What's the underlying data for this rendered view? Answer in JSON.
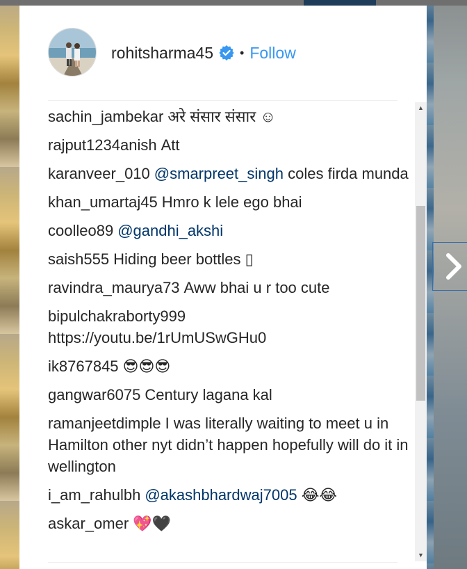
{
  "post_header": {
    "username": "rohitsharma45",
    "separator": "•",
    "follow_label": "Follow"
  },
  "icons": {
    "verified": "verified-badge-icon",
    "next": "chevron-right-icon",
    "scroll_up": "scroll-up-arrow-icon",
    "scroll_down": "scroll-down-arrow-icon"
  },
  "colors": {
    "follow": "#3897f0",
    "mention": "#003569",
    "verified": "#3897f0",
    "text": "#262626"
  },
  "comments": [
    {
      "user": "sachin_jambekar",
      "text": "अरे संसार संसार ☺",
      "mention": ""
    },
    {
      "user": "rajput1234anish",
      "text": "Att",
      "mention": ""
    },
    {
      "user": "karanveer_010",
      "mention": "@smarpreet_singh",
      "text": "coles firda munda"
    },
    {
      "user": "khan_umartaj45",
      "text": "Hmro k lele ego bhai",
      "mention": ""
    },
    {
      "user": "coolleo89",
      "mention": "@gandhi_akshi",
      "text": ""
    },
    {
      "user": "saish555",
      "text": "Hiding beer bottles ▯",
      "mention": ""
    },
    {
      "user": "ravindra_maurya73",
      "text": "Aww bhai u r too cute",
      "mention": ""
    },
    {
      "user": "bipulchakraborty999",
      "text": "https://youtu.be/1rUmUSwGHu0",
      "mention": ""
    },
    {
      "user": "ik8767845",
      "text": "😎😎😎",
      "mention": ""
    },
    {
      "user": "gangwar6075",
      "text": "Century lagana kal",
      "mention": ""
    },
    {
      "user": "ramanjeetdimple",
      "text": "I was literally waiting to meet u in Hamilton other nyt didn’t happen hopefully will do it in wellington",
      "mention": ""
    },
    {
      "user": "i_am_rahulbh",
      "mention": "@akashbhardwaj7005",
      "text": "😂😂"
    },
    {
      "user": "askar_omer",
      "text": "💖🖤",
      "mention": ""
    }
  ]
}
